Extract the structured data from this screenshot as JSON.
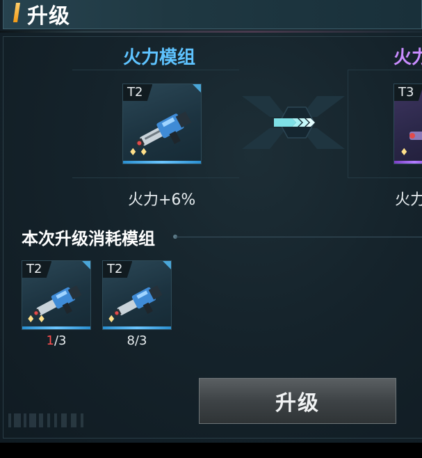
{
  "header": {
    "title": "升级"
  },
  "current_module": {
    "title": "火力模组",
    "title_color": "#5ec3ff",
    "tier": "T2",
    "stars": "♦♦",
    "stat": "火力+6%"
  },
  "next_module": {
    "title": "火力",
    "title_color": "#c98cff",
    "tier": "T3",
    "stars": "♦",
    "stat": "火力"
  },
  "consume_section": {
    "title": "本次升级消耗模组",
    "items": [
      {
        "tier": "T2",
        "stars": "♦♦",
        "have": "1",
        "need": "/3",
        "have_color": "#ff5050"
      },
      {
        "tier": "T2",
        "stars": "♦",
        "have": "8",
        "need": "/3",
        "have_color": "#e9eef0"
      }
    ]
  },
  "upgrade_button": {
    "label": "升级"
  },
  "icons": [
    "weapon-icon",
    "double-chevron-right-icon",
    "star-icon"
  ]
}
